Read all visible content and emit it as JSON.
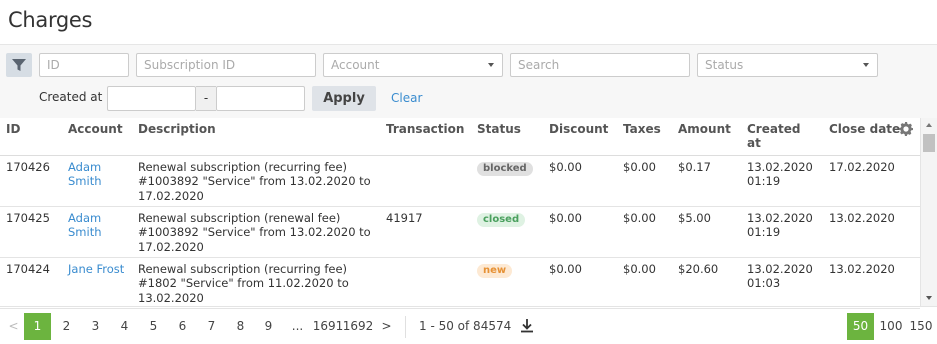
{
  "page": {
    "title": "Charges"
  },
  "filters": {
    "id_placeholder": "ID",
    "subscription_placeholder": "Subscription ID",
    "account_placeholder": "Account",
    "search_placeholder": "Search",
    "status_placeholder": "Status",
    "created_at_label": "Created at",
    "date_separator": "-",
    "apply_label": "Apply",
    "clear_label": "Clear"
  },
  "table": {
    "headers": {
      "id": "ID",
      "account": "Account",
      "description": "Description",
      "transaction": "Transaction",
      "status": "Status",
      "discount": "Discount",
      "taxes": "Taxes",
      "amount": "Amount",
      "created_at": "Created at",
      "close_date": "Close date"
    },
    "rows": [
      {
        "id": "170426",
        "account": "Adam Smith",
        "description": "Renewal subscription (recurring fee) #1003892 \"Service\" from 13.02.2020 to 17.02.2020",
        "transaction": "",
        "status": "blocked",
        "discount": "$0.00",
        "taxes": "$0.00",
        "amount": "$0.17",
        "created_at": "13.02.2020 01:19",
        "close_date": "17.02.2020"
      },
      {
        "id": "170425",
        "account": "Adam Smith",
        "description": "Renewal subscription (renewal fee) #1003892 \"Service\" from 13.02.2020 to 17.02.2020",
        "transaction": "41917",
        "status": "closed",
        "discount": "$0.00",
        "taxes": "$0.00",
        "amount": "$5.00",
        "created_at": "13.02.2020 01:19",
        "close_date": "13.02.2020"
      },
      {
        "id": "170424",
        "account": "Jane Frost",
        "description": "Renewal subscription (recurring fee) #1802 \"Service\" from 11.02.2020 to 13.02.2020",
        "transaction": "",
        "status": "new",
        "discount": "$0.00",
        "taxes": "$0.00",
        "amount": "$20.60",
        "created_at": "13.02.2020 01:03",
        "close_date": "13.02.2020"
      }
    ]
  },
  "pagination": {
    "prev": "<",
    "next": ">",
    "pages": [
      "1",
      "2",
      "3",
      "4",
      "5",
      "6",
      "7",
      "8",
      "9",
      "...",
      "1691",
      "1692"
    ],
    "current": "1",
    "range_info": "1 - 50 of 84574",
    "page_sizes": [
      "50",
      "100",
      "150"
    ],
    "selected_page_size": "50"
  },
  "colors": {
    "accent_green": "#6cb43f",
    "link_blue": "#3a8ccf",
    "status_blocked": "#666666",
    "status_closed": "#4aa05e",
    "status_new": "#e69135"
  },
  "icons": {
    "filter": "filter-icon",
    "settings": "gear-icon",
    "download": "download-icon"
  }
}
